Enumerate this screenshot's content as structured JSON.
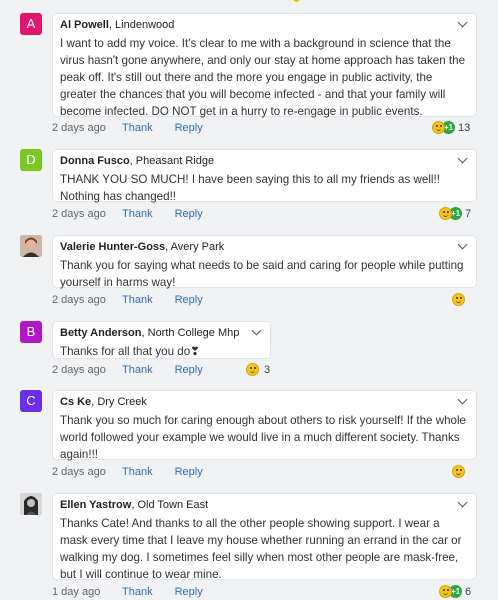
{
  "comments": [
    {
      "initial": "A",
      "avatar_color": "#e0176d",
      "avatar_type": "letter",
      "name": "Al Powell",
      "place": "Lindenwood",
      "text": "I want to add my voice. It's clear to me with a background in science that the virus hasn't gone anywhere, and only our stay at home approach has taken the peak off. It's still out there and the more you engage in public activity, the greater the chances that you will become infected - and that your family will become infected. DO NOT get in a hurry to re-engage in public events.",
      "time": "2 days ago",
      "thank": "Thank",
      "reply": "Reply",
      "reactions": [
        "smile-icon",
        "plus-one-icon"
      ],
      "plus_label": "+1",
      "count": "13"
    },
    {
      "initial": "D",
      "avatar_color": "#7cc623",
      "avatar_type": "letter",
      "name": "Donna Fusco",
      "place": "Pheasant Ridge",
      "text": "THANK YOU SO MUCH!  I have been saying this to all my friends as well!! Nothing has changed!!",
      "time": "2 days ago",
      "thank": "Thank",
      "reply": "Reply",
      "reactions": [
        "smile-icon",
        "plus-one-icon"
      ],
      "plus_label": "+1",
      "count": "7"
    },
    {
      "initial": "",
      "avatar_color": "#8a5a3a",
      "avatar_type": "photo",
      "name": "Valerie Hunter-Goss",
      "place": "Avery Park",
      "text": "Thank you for saying what needs to be said and caring for people while putting yourself in harms way!",
      "time": "2 days ago",
      "thank": "Thank",
      "reply": "Reply",
      "reactions": [
        "smile-icon"
      ],
      "count": ""
    },
    {
      "initial": "B",
      "avatar_color": "#b316c9",
      "avatar_type": "letter",
      "name": "Betty Anderson",
      "place": "North College Mhp",
      "text": "Thanks for all that you do❣",
      "time": "2 days ago",
      "thank": "Thank",
      "reply": "Reply",
      "reactions": [
        "smile-icon"
      ],
      "count": "3"
    },
    {
      "initial": "C",
      "avatar_color": "#6a2ee8",
      "avatar_type": "letter",
      "name": "Cs Ke",
      "place": "Dry Creek",
      "text": "Thank you so much for caring enough about others to risk yourself!  If the whole world followed your example we would live in a much different society. Thanks again!!!",
      "time": "2 days ago",
      "thank": "Thank",
      "reply": "Reply",
      "reactions": [
        "smile-icon"
      ],
      "count": ""
    },
    {
      "initial": "",
      "avatar_color": "#777777",
      "avatar_type": "photo",
      "name": "Ellen Yastrow",
      "place": "Old Town East",
      "text": "Thanks Cate! And thanks to all the other people showing support. I wear a mask every time that I leave my house whether running an errand in the car or walking my dog. I sometimes feel silly when most other people are mask-free, but I will continue to wear mine.",
      "time": "1 day ago",
      "thank": "Thank",
      "reply": "Reply",
      "reactions": [
        "smile-icon",
        "plus-one-icon"
      ],
      "plus_label": "+1",
      "count": "6"
    }
  ]
}
